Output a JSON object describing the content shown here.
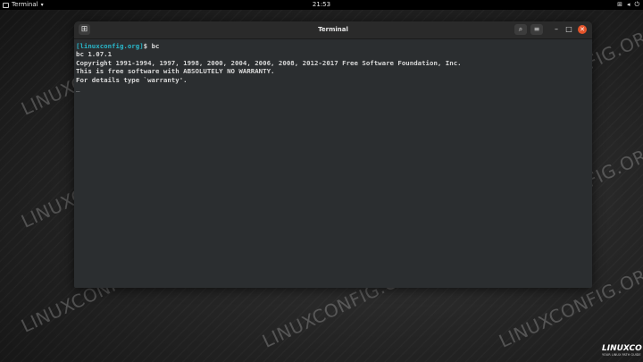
{
  "topbar": {
    "activity_label": "Terminal",
    "clock": "21:53"
  },
  "window": {
    "title": "Terminal"
  },
  "terminal": {
    "prompt_user": "[linuxconfig.org]",
    "prompt_symbol": "$ ",
    "command": "bc",
    "lines": [
      "bc 1.07.1",
      "Copyright 1991-1994, 1997, 1998, 2000, 2004, 2006, 2008, 2012-2017 Free Software Foundation, Inc.",
      "This is free software with ABSOLUTELY NO WARRANTY.",
      "For details type `warranty'."
    ],
    "cursor": "_"
  },
  "watermark": "LINUXCONFIG.ORG",
  "logo": {
    "text": "LINUXCO",
    "sub": "YOUR LINUX PATH GUIDE"
  },
  "colors": {
    "prompt": "#29b6c9",
    "close_button": "#e4542b",
    "terminal_bg": "#2b2e30"
  }
}
